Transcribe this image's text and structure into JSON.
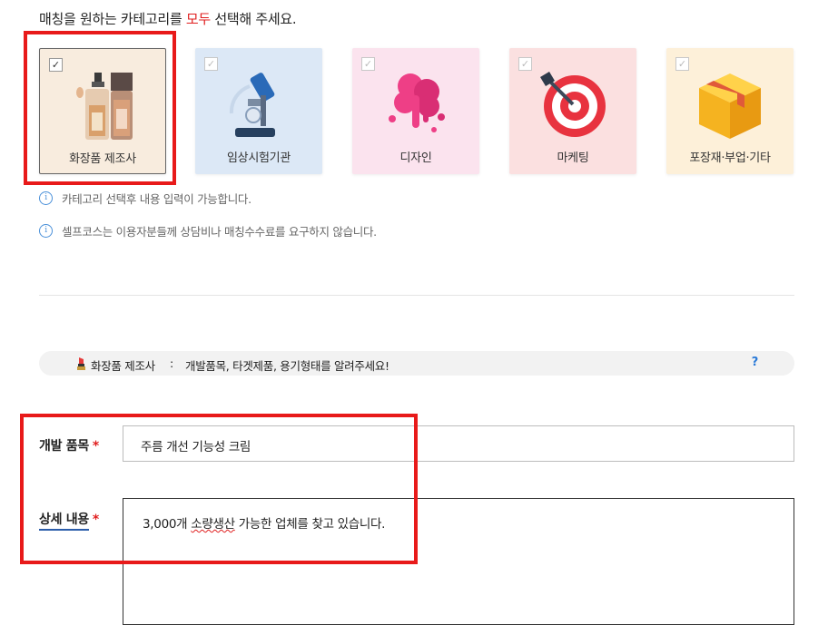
{
  "instruction": {
    "before": "매칭을 원하는 카테고리를 ",
    "highlight": "모두",
    "after": " 선택해 주세요."
  },
  "categories": [
    {
      "label": "화장품 제조사",
      "icon": "cosmetics-bottles-icon",
      "selected": true,
      "bg": "#f8ecde"
    },
    {
      "label": "임상시험기관",
      "icon": "microscope-icon",
      "selected": false,
      "bg": "#dce8f6"
    },
    {
      "label": "디자인",
      "icon": "paint-splash-icon",
      "selected": false,
      "bg": "#fbe3ee"
    },
    {
      "label": "마케팅",
      "icon": "target-dart-icon",
      "selected": false,
      "bg": "#fbe0e0"
    },
    {
      "label": "포장재·부업·기타",
      "icon": "package-box-icon",
      "selected": false,
      "bg": "#fdf0d9"
    }
  ],
  "checkmark": "✓",
  "notes": {
    "info_icon": "i",
    "n1": "카테고리 선택후 내용 입력이 가능합니다.",
    "n2": "셀프코스는 이용자분들께 상담비나 매칭수수료를 요구하지 않습니다."
  },
  "guide": {
    "category": "화장품 제조사",
    "colon": ":",
    "message": "개발품목, 타겟제품, 용기형태를 알려주세요!",
    "help": "?"
  },
  "form": {
    "item_label": "개발 품목",
    "item_value": "주름 개선 기능성 크림",
    "detail_label": "상세 내용",
    "detail_value": {
      "pre": "3,000개 ",
      "misspelled": "소량생산",
      "post": " 가능한 업체를 찾고 있습니다."
    },
    "required_mark": "*"
  },
  "colors": {
    "accent_red": "#e02020",
    "highlight_box": "#e81a1a",
    "link_blue": "#2a7ad8"
  }
}
